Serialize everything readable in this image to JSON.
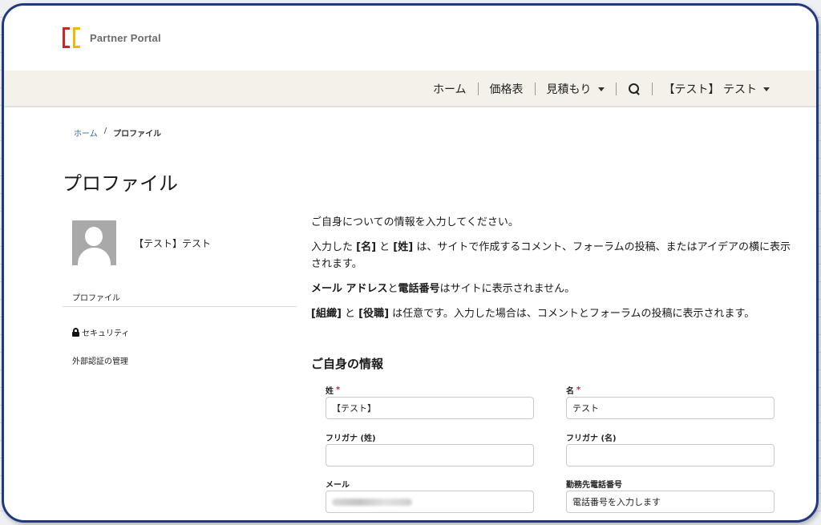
{
  "logo": {
    "text": "Partner Portal",
    "colors": {
      "red": "#c62828",
      "yellow": "#f2b705"
    }
  },
  "nav": {
    "items": [
      {
        "label": "ホーム"
      },
      {
        "label": "価格表"
      },
      {
        "label": "見積もり",
        "dropdown": true
      }
    ],
    "search_icon": "search-icon",
    "user": {
      "label": "【テスト】 テスト",
      "dropdown": true
    }
  },
  "breadcrumb": {
    "home": "ホーム",
    "separator": "/",
    "current": "プロファイル"
  },
  "page_title": "プロファイル",
  "profile": {
    "name": "【テスト】テスト"
  },
  "side_menu": {
    "profile": "プロファイル",
    "security": "セキュリティ",
    "external_auth": "外部認証の管理"
  },
  "intro": {
    "line1": "ご自身についての情報を入力してください。",
    "line2_pre": "入力した ",
    "line2_b1": "[名]",
    "line2_mid": " と ",
    "line2_b2": "[姓]",
    "line2_post": " は、サイトで作成するコメント、フォーラムの投稿、またはアイデアの横に表示されます。",
    "line3_b1": "メール アドレス",
    "line3_mid": "と",
    "line3_b2": "電話番号",
    "line3_post": "はサイトに表示されません。",
    "line4_b1": "[組織]",
    "line4_mid": " と ",
    "line4_b2": "[役職]",
    "line4_post": " は任意です。入力した場合は、コメントとフォーラムの投稿に表示されます。"
  },
  "section_title": "ご自身の情報",
  "form": {
    "last_name": {
      "label": "姓",
      "required_mark": "*",
      "value": "【テスト】"
    },
    "first_name": {
      "label": "名",
      "required_mark": "*",
      "value": "テスト"
    },
    "furigana_last": {
      "label": "フリガナ (姓)",
      "value": ""
    },
    "furigana_first": {
      "label": "フリガナ (名)",
      "value": ""
    },
    "email": {
      "label": "メール",
      "value_hidden": true
    },
    "work_phone": {
      "label": "勤務先電話番号",
      "placeholder": "電話番号を入力します"
    }
  }
}
